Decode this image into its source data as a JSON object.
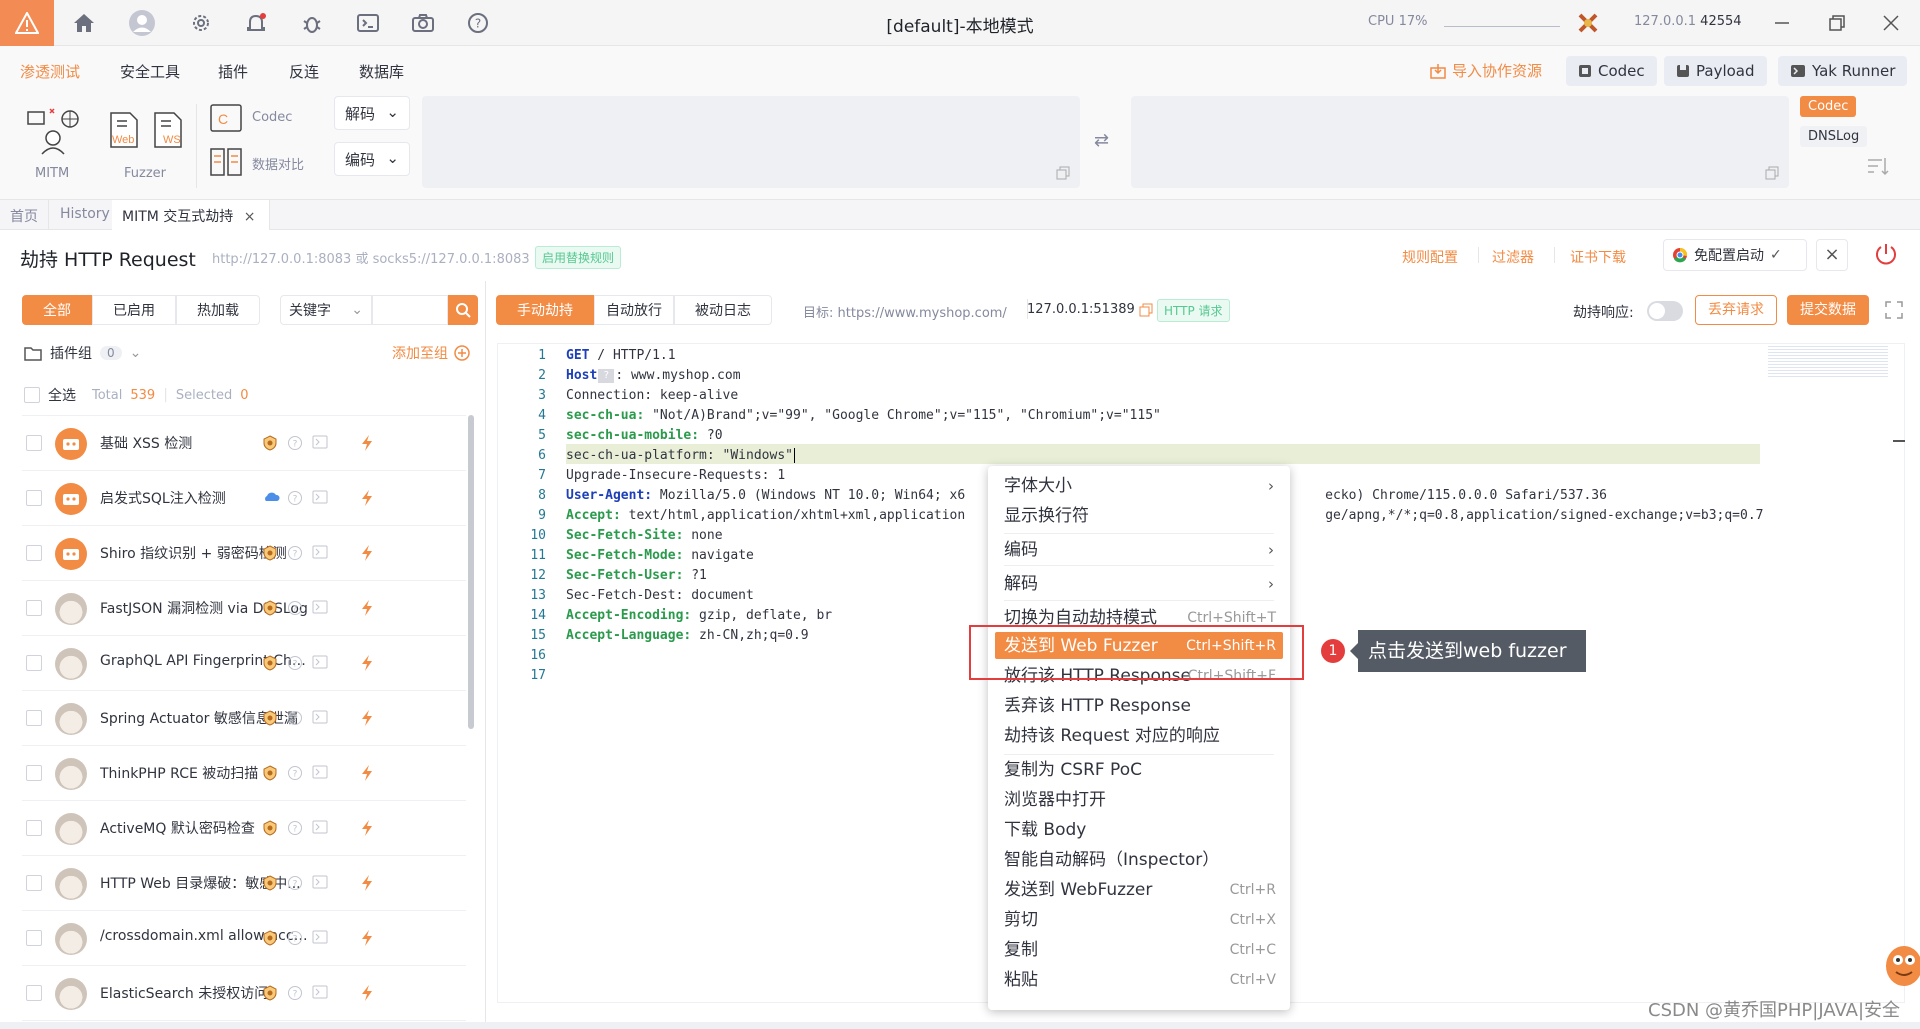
{
  "window": {
    "title": "[default]-本地模式",
    "cpu_label": "CPU",
    "cpu_value": "17%",
    "ip": "127.0.0.1",
    "port": "42554"
  },
  "menubar": {
    "items": [
      "渗透测试",
      "安全工具",
      "插件",
      "反连",
      "数据库"
    ],
    "import": "导入协作资源",
    "codec": "Codec",
    "payload": "Payload",
    "yakrunner": "Yak Runner"
  },
  "toolbar": {
    "mitm": "MITM",
    "fuzzer": "Fuzzer",
    "codec": "Codec",
    "compare": "数据对比",
    "decode": "解码",
    "encode": "编码",
    "tag_codec": "Codec",
    "tag_dnslog": "DNSLog",
    "web": "Web",
    "ws": "WS"
  },
  "tabs": [
    "首页",
    "History",
    "MITM 交互式劫持"
  ],
  "header": {
    "title": "劫持 HTTP Request",
    "proxy": "http://127.0.0.1:8083 或 socks5://127.0.0.1:8083",
    "replace_rule": "启用替换规则",
    "rule_config": "规则配置",
    "filter": "过滤器",
    "cert_download": "证书下载",
    "free_config": "免配置启动"
  },
  "left": {
    "filters": [
      "全部",
      "已启用",
      "热加载"
    ],
    "keyword": "关键字",
    "group_label": "插件组",
    "group_count": "0",
    "add_to_group": "添加至组",
    "select_all": "全选",
    "total_label": "Total",
    "total_value": "539",
    "selected_label": "Selected",
    "selected_value": "0",
    "plugins": [
      "基础 XSS 检测",
      "启发式SQL注入检测",
      "Shiro 指纹识别 + 弱密码检测",
      "FastJSON 漏洞检测 via DNSLog",
      "GraphQL API Fingerprint Chec...",
      "Spring Actuator 敏感信息泄漏",
      "ThinkPHP RCE 被动扫描",
      "ActiveMQ 默认密码检查",
      "HTTP Web 目录爆破：敏感中...",
      "/crossdomain.xml allow-acces...",
      "ElasticSearch 未授权访问"
    ]
  },
  "right": {
    "modes": [
      "手动劫持",
      "自动放行",
      "被动日志"
    ],
    "target_label": "目标:",
    "target_url": "https://www.myshop.com/",
    "client": "127.0.0.1:51389",
    "http_tag": "HTTP 请求",
    "hijack_response": "劫持响应:",
    "discard": "丢弃请求",
    "submit": "提交数据"
  },
  "code": [
    {
      "n": "1",
      "k": "GET",
      "v": " / HTTP/1.1",
      "t": "method"
    },
    {
      "n": "2",
      "k": "Host",
      "v": ": www.myshop.com",
      "t": "header-key"
    },
    {
      "n": "3",
      "k": "",
      "v": "Connection: keep-alive",
      "t": "plain"
    },
    {
      "n": "4",
      "k": "sec-ch-ua:",
      "v": " \"Not/A)Brand\";v=\"99\", \"Google Chrome\";v=\"115\", \"Chromium\";v=\"115\"",
      "t": "header"
    },
    {
      "n": "5",
      "k": "sec-ch-ua-mobile:",
      "v": " ?0",
      "t": "header"
    },
    {
      "n": "6",
      "k": "",
      "v": "sec-ch-ua-platform: \"Windows\"",
      "t": "plain"
    },
    {
      "n": "7",
      "k": "",
      "v": "Upgrade-Insecure-Requests: 1",
      "t": "plain"
    },
    {
      "n": "8",
      "k": "User-Agent:",
      "v": " Mozilla/5.0 (Windows NT 10.0; Win64; x6                                              ecko) Chrome/115.0.0.0 Safari/537.36",
      "t": "header-blue"
    },
    {
      "n": "9",
      "k": "Accept:",
      "v": " text/html,application/xhtml+xml,application                                              ge/apng,*/*;q=0.8,application/signed-exchange;v=b3;q=0.7",
      "t": "header"
    },
    {
      "n": "10",
      "k": "Sec-Fetch-Site:",
      "v": " none",
      "t": "header"
    },
    {
      "n": "11",
      "k": "Sec-Fetch-Mode:",
      "v": " navigate",
      "t": "header"
    },
    {
      "n": "12",
      "k": "Sec-Fetch-User:",
      "v": " ?1",
      "t": "header"
    },
    {
      "n": "13",
      "k": "",
      "v": "Sec-Fetch-Dest: document",
      "t": "plain"
    },
    {
      "n": "14",
      "k": "Accept-Encoding:",
      "v": " gzip, deflate, br",
      "t": "header"
    },
    {
      "n": "15",
      "k": "Accept-Language:",
      "v": " zh-CN,zh;q=0.9",
      "t": "header"
    },
    {
      "n": "16",
      "k": "",
      "v": "",
      "t": "plain"
    },
    {
      "n": "17",
      "k": "",
      "v": "",
      "t": "plain"
    }
  ],
  "context_menu": {
    "font_size": "字体大小",
    "show_wrap": "显示换行符",
    "encode": "编码",
    "decode": "解码",
    "switch_auto": "切换为自动劫持模式",
    "switch_auto_sc": "Ctrl+Shift+T",
    "send_fuzzer": "发送到 Web Fuzzer",
    "send_fuzzer_sc": "Ctrl+Shift+R",
    "pass_response": "放行该 HTTP Response",
    "pass_response_sc": "Ctrl+Shift+F",
    "drop_response": "丢弃该 HTTP Response",
    "hijack_response": "劫持该 Request 对应的响应",
    "csrf": "复制为 CSRF PoC",
    "open_browser": "浏览器中打开",
    "download_body": "下载 Body",
    "smart_decode": "智能自动解码（Inspector）",
    "send_webfuzzer": "发送到 WebFuzzer",
    "send_webfuzzer_sc": "Ctrl+R",
    "cut": "剪切",
    "cut_sc": "Ctrl+X",
    "copy": "复制",
    "copy_sc": "Ctrl+C",
    "paste": "粘贴",
    "paste_sc": "Ctrl+V"
  },
  "annotation": {
    "step": "1",
    "tip": "点击发送到web fuzzer"
  },
  "watermark": "CSDN @黄乔国PHP|JAVA|安全",
  "colors": {
    "accent": "#f28b44",
    "annotation_red": "#e43d3d"
  }
}
